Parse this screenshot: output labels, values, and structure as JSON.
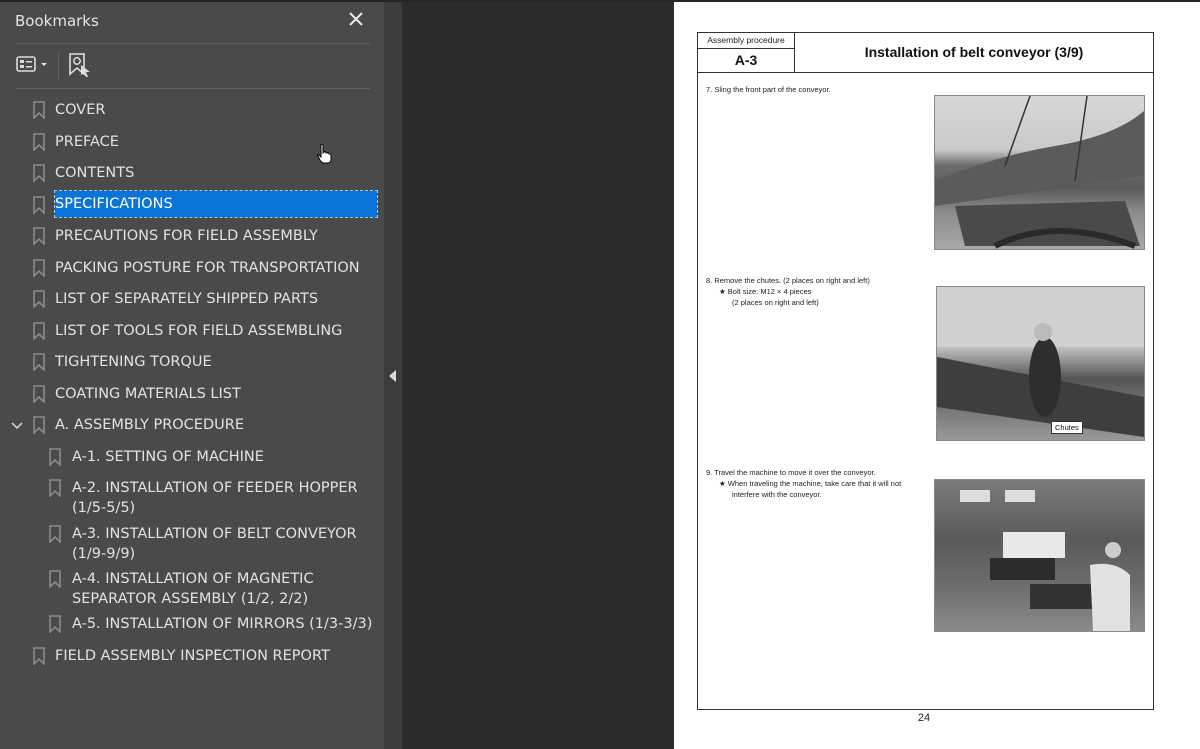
{
  "sidebar": {
    "title": "Bookmarks",
    "close_icon": "close-icon",
    "options_icon": "bookmark-options-icon",
    "find_icon": "find-current-bookmark-icon",
    "items": [
      {
        "label": "COVER",
        "level": 0
      },
      {
        "label": "PREFACE",
        "level": 0
      },
      {
        "label": "CONTENTS",
        "level": 0
      },
      {
        "label": "SPECIFICATIONS",
        "level": 0,
        "selected": true
      },
      {
        "label": "PRECAUTIONS FOR FIELD ASSEMBLY",
        "level": 0
      },
      {
        "label": "PACKING POSTURE FOR TRANSPORTATION",
        "level": 0
      },
      {
        "label": "LIST OF SEPARATELY SHIPPED PARTS",
        "level": 0
      },
      {
        "label": "LIST OF TOOLS FOR FIELD ASSEMBLING",
        "level": 0
      },
      {
        "label": "TIGHTENING TORQUE",
        "level": 0
      },
      {
        "label": "COATING MATERIALS LIST",
        "level": 0
      },
      {
        "label": "A. ASSEMBLY PROCEDURE",
        "level": 0,
        "expanded": true
      },
      {
        "label": "A-1. SETTING OF MACHINE",
        "level": 1
      },
      {
        "label": "A-2. INSTALLATION OF FEEDER HOPPER (1/5-5/5)",
        "level": 1
      },
      {
        "label": "A-3. INSTALLATION OF BELT CONVEYOR (1/9-9/9)",
        "level": 1
      },
      {
        "label": "A-4. INSTALLATION OF MAGNETIC SEPARATOR ASSEMBLY (1/2, 2/2)",
        "level": 1
      },
      {
        "label": "A-5. INSTALLATION OF MIRRORS (1/3-3/3)",
        "level": 1
      },
      {
        "label": "FIELD ASSEMBLY INSPECTION REPORT",
        "level": 0
      }
    ],
    "selected_color": "#0a74d8"
  },
  "document": {
    "header_label": "Assembly procedure",
    "header_code": "A-3",
    "title": "Installation of belt conveyor (3/9)",
    "steps": [
      {
        "text": "7.   Sling the front part of the conveyor.",
        "notes": []
      },
      {
        "text": "8.   Remove the chutes.  (2 places on right and left)",
        "notes": [
          "★  Bolt size: M12 × 4 pieces",
          "(2 places on right and left)"
        ]
      },
      {
        "text": "9.   Travel the machine to move it over the conveyor.",
        "notes": [
          "★  When traveling the machine, take care that it will not",
          "interfere with the conveyor."
        ]
      }
    ],
    "callout": "Chutes",
    "page_number": "24"
  }
}
